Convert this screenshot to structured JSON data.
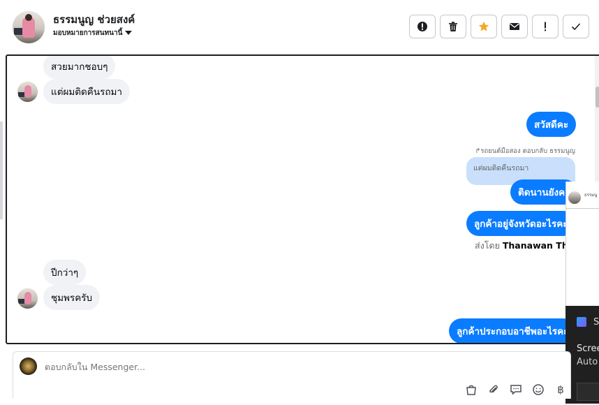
{
  "header": {
    "contact_name": "ธรรมนูญ ช่วยสงค์",
    "assign_label": "มอบหมายการสนทนานี้"
  },
  "toolbar": {
    "icons": [
      "alert-icon",
      "trash-icon",
      "star-icon",
      "mail-icon",
      "exclamation-icon",
      "checkmark-icon"
    ],
    "star_color": "#f5a623"
  },
  "thread": {
    "messages": [
      {
        "side": "in",
        "text": "สวยมากชอบๆ"
      },
      {
        "side": "in",
        "text": "แต่ผมติดคืนรถมา"
      },
      {
        "side": "out",
        "text": "สวัสดีคะ"
      },
      {
        "reply_note": "↱รถยนต์มือสอง ตอบกลับ ธรรมนูญ"
      },
      {
        "quoted": "แต่ผมติดคืนรถมา"
      },
      {
        "side": "out",
        "text": "ติดนานยังคะ"
      },
      {
        "side": "out",
        "text": "ลูกค้าอยู่จังหวัดอะไรคะ"
      },
      {
        "sent_by_prefix": "ส่งโดย",
        "sent_by_name": "Thanawan Thon"
      },
      {
        "side": "in",
        "text": "ปีกว่าๆ"
      },
      {
        "side": "in",
        "text": "ชุมพรครับ"
      },
      {
        "side": "out",
        "text": "ลูกค้าประกอบอาชีพอะไรคะ"
      }
    ],
    "outgoing_color": "#0a7cff",
    "incoming_color": "#f0f2f5"
  },
  "overlay": {
    "card_name": "ธรรมนู",
    "notification_title": "S",
    "notification_line1": "Scree",
    "notification_line2": "Auto"
  },
  "composer": {
    "placeholder": "ตอบกลับใน Messenger...",
    "icons": [
      "bag-icon",
      "paperclip-icon",
      "chat-bubble-icon",
      "emoji-icon",
      "baht-icon"
    ],
    "baht_symbol": "฿"
  }
}
